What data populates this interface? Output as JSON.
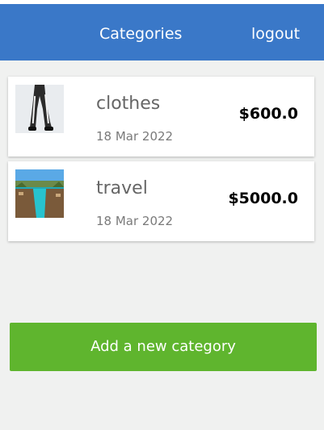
{
  "header": {
    "title": "Categories",
    "logout_label": "logout",
    "background": "#3a78c8"
  },
  "categories": [
    {
      "name": "clothes",
      "date": "18 Mar 2022",
      "amount": "$600.0",
      "thumbnail_icon": "pants-photo"
    },
    {
      "name": "travel",
      "date": "18 Mar 2022",
      "amount": "$5000.0",
      "thumbnail_icon": "resort-pool-photo"
    }
  ],
  "add_button": {
    "label": "Add a new category",
    "background": "#5fb52e"
  }
}
